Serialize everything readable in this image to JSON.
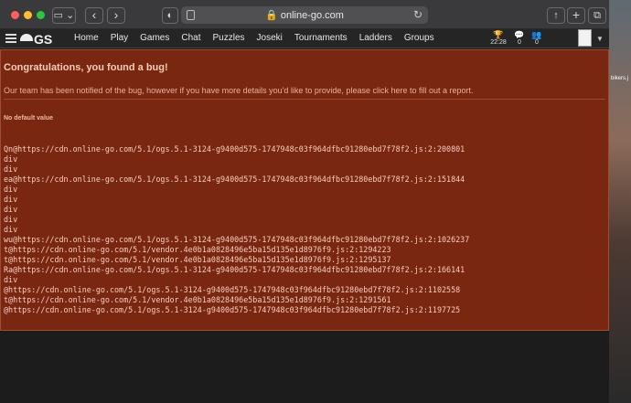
{
  "browser": {
    "url": "online-go.com",
    "buttons": {
      "back": "‹",
      "forward": "›",
      "share": "↑",
      "new_tab": "+",
      "tabs": "⧉",
      "sidebar": "▭",
      "shield": "◐",
      "reload": "↻"
    }
  },
  "nav": {
    "logo_text": "GS",
    "links": [
      "Home",
      "Play",
      "Games",
      "Chat",
      "Puzzles",
      "Joseki",
      "Tournaments",
      "Ladders",
      "Groups"
    ],
    "clock": {
      "icon": "trophy-icon",
      "value": "22:28"
    },
    "messages": {
      "icon": "chat-bubble-icon",
      "count": "0"
    },
    "friends": {
      "icon": "users-icon",
      "count": "0"
    }
  },
  "error": {
    "heading": "Congratulations, you found a bug!",
    "subtext": "Our team has been notified of the bug, however if you have more details you'd like to provide, please click here to fill out a report.",
    "default_label": "No default value",
    "trace": [
      "Qn@https://cdn.online-go.com/5.1/ogs.5.1-3124-g9400d575-1747948c03f964dfbc91280ebd7f78f2.js:2:200801",
      "div",
      "div",
      "ea@https://cdn.online-go.com/5.1/ogs.5.1-3124-g9400d575-1747948c03f964dfbc91280ebd7f78f2.js:2:151844",
      "div",
      "div",
      "div",
      "div",
      "div",
      "wu@https://cdn.online-go.com/5.1/ogs.5.1-3124-g9400d575-1747948c03f964dfbc91280ebd7f78f2.js:2:1026237",
      "t@https://cdn.online-go.com/5.1/vendor.4e0b1a0828496e5ba15d135e1d8976f9.js:2:1294223",
      "t@https://cdn.online-go.com/5.1/vendor.4e0b1a0828496e5ba15d135e1d8976f9.js:2:1295137",
      "Ra@https://cdn.online-go.com/5.1/ogs.5.1-3124-g9400d575-1747948c03f964dfbc91280ebd7f78f2.js:2:166141",
      "div",
      "@https://cdn.online-go.com/5.1/ogs.5.1-3124-g9400d575-1747948c03f964dfbc91280ebd7f78f2.js:2:1102558",
      "t@https://cdn.online-go.com/5.1/vendor.4e0b1a0828496e5ba15d135e1d8976f9.js:2:1291561",
      "@https://cdn.online-go.com/5.1/ogs.5.1-3124-g9400d575-1747948c03f964dfbc91280ebd7f78f2.js:2:1197725"
    ]
  },
  "background_fragment": "bikers.j"
}
